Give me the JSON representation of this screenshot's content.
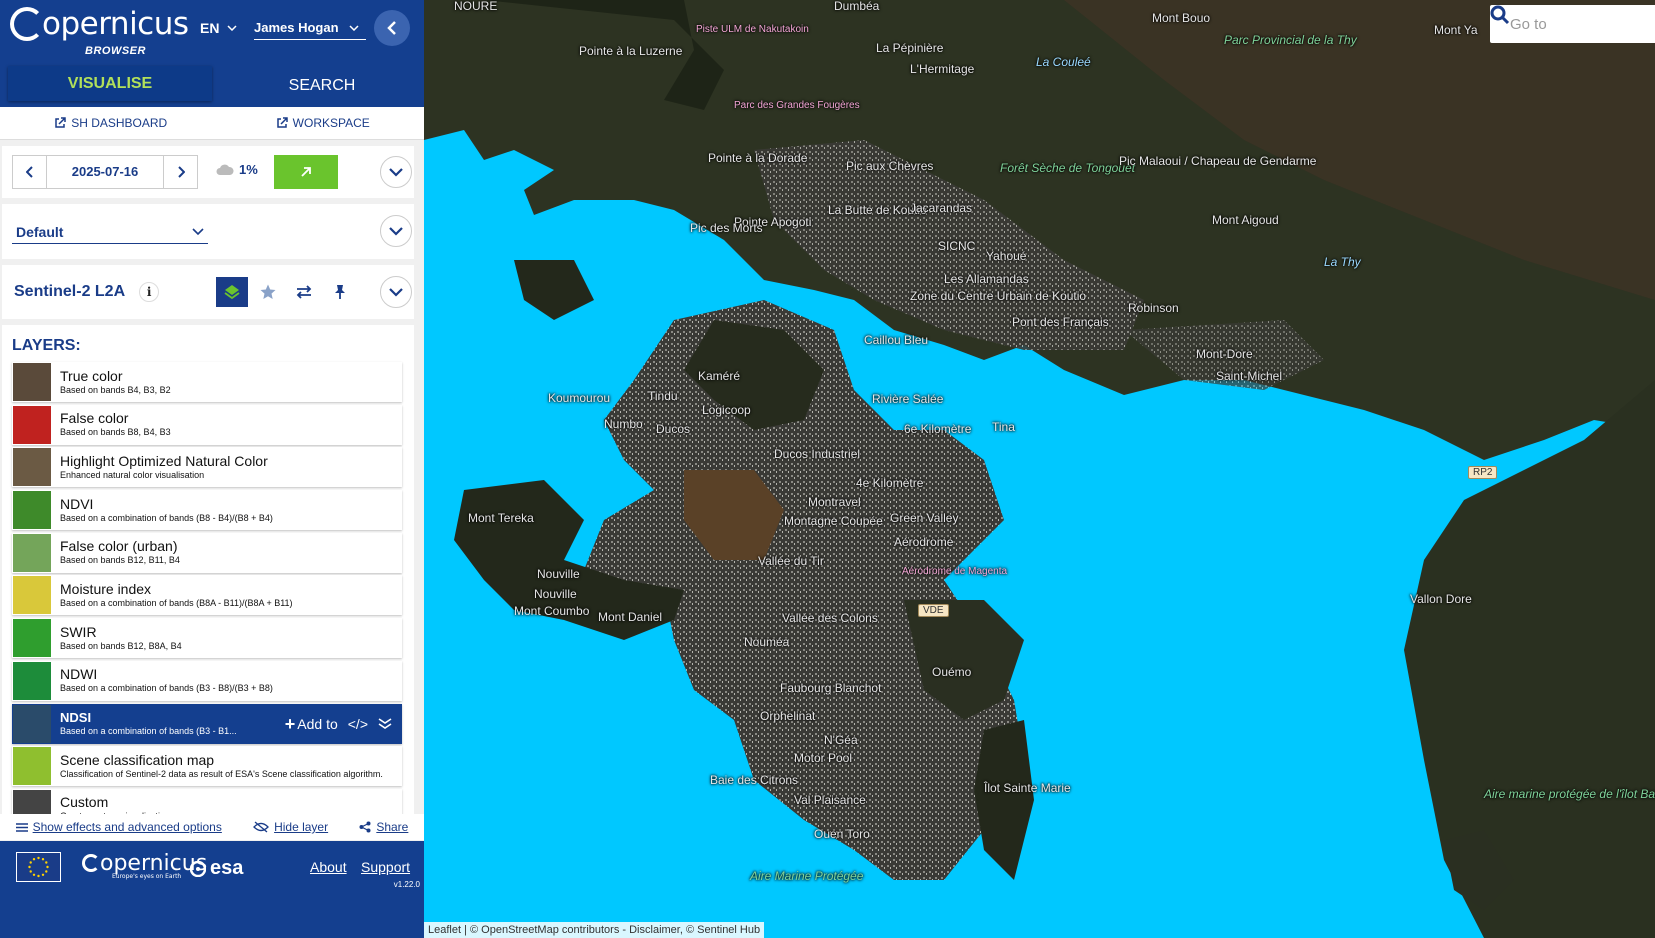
{
  "header": {
    "brand": "opernicus",
    "sub": "BROWSER",
    "lang": "EN",
    "user": "James Hogan"
  },
  "tabs": [
    {
      "label": "VISUALISE",
      "active": true
    },
    {
      "label": "SEARCH",
      "active": false
    }
  ],
  "links": {
    "dashboard": "SH DASHBOARD",
    "workspace": "WORKSPACE"
  },
  "date_panel": {
    "date": "2025-07-16",
    "cloud": "1%"
  },
  "theme": {
    "selected": "Default"
  },
  "dataset": {
    "title": "Sentinel-2 L2A"
  },
  "layers": {
    "title": "LAYERS:",
    "items": [
      {
        "name": "True color",
        "desc": "Based on bands B4, B3, B2",
        "thumb": "#5a4a3a"
      },
      {
        "name": "False color",
        "desc": "Based on bands B8, B4, B3",
        "thumb": "#c0221f"
      },
      {
        "name": "Highlight Optimized Natural Color",
        "desc": "Enhanced natural color visualisation",
        "thumb": "#6b5a44"
      },
      {
        "name": "NDVI",
        "desc": "Based on a combination of bands (B8 - B4)/(B8 + B4)",
        "thumb": "#3e8a2a"
      },
      {
        "name": "False color (urban)",
        "desc": "Based on bands B12, B11, B4",
        "thumb": "#74a55a"
      },
      {
        "name": "Moisture index",
        "desc": "Based on a combination of bands (B8A - B11)/(B8A + B11)",
        "thumb": "#d9c83a"
      },
      {
        "name": "SWIR",
        "desc": "Based on bands B12, B8A, B4",
        "thumb": "#2f9e2e"
      },
      {
        "name": "NDWI",
        "desc": "Based on a combination of bands (B3 - B8)/(B3 + B8)",
        "thumb": "#1d8c3a"
      },
      {
        "name": "NDSI",
        "desc": "Based on a combination of bands (B3 - B1...",
        "thumb": "#2a4b6a",
        "selected": true
      },
      {
        "name": "Scene classification map",
        "desc": "Classification of Sentinel-2 data as result of ESA's Scene classification algorithm.",
        "thumb": "#8fbf2f"
      },
      {
        "name": "Custom",
        "desc": "Create custom visualisation",
        "thumb": "#444444"
      }
    ],
    "add_to_label": "Add to",
    "code_label": "</>"
  },
  "bottom_links": {
    "effects": "Show effects and advanced options",
    "hide": "Hide layer",
    "share": "Share"
  },
  "footer": {
    "copernicus": "opernicus",
    "copernicus_tag": "Europe's eyes on Earth",
    "esa": "esa",
    "about": "About",
    "support": "Support",
    "version": "v1.22.0"
  },
  "map": {
    "search_placeholder": "Go to",
    "attribution": "Leaflet | © OpenStreetMap contributors - Disclaimer, © Sentinel Hub",
    "labels": [
      {
        "text": "NOURE",
        "cls": ""
      },
      {
        "text": "Dumbéa",
        "cls": ""
      },
      {
        "text": "Mont Bouo",
        "cls": ""
      },
      {
        "text": "Mont Ya",
        "cls": ""
      },
      {
        "text": "Parc Provincial de la Thy",
        "cls": "green"
      },
      {
        "text": "Piste ULM de Nakutakoin",
        "cls": "pink"
      },
      {
        "text": "Pointe à la Luzerne",
        "cls": ""
      },
      {
        "text": "La Pépinière",
        "cls": ""
      },
      {
        "text": "L'Hermitage",
        "cls": ""
      },
      {
        "text": "La Couleé",
        "cls": "blue"
      },
      {
        "text": "Parc des Grandes Fougères",
        "cls": "pink"
      },
      {
        "text": "Pointe à la Dorade",
        "cls": ""
      },
      {
        "text": "Pic aux Chèvres",
        "cls": ""
      },
      {
        "text": "Forêt Sèche de Tongouet",
        "cls": "green"
      },
      {
        "text": "Pic Malaoui / Chapeau de Gendarme",
        "cls": ""
      },
      {
        "text": "La Butte de Koutio",
        "cls": ""
      },
      {
        "text": "Jacarandas",
        "cls": ""
      },
      {
        "text": "Pointe Apogoti",
        "cls": ""
      },
      {
        "text": "Pic des Morts",
        "cls": ""
      },
      {
        "text": "SICNC",
        "cls": ""
      },
      {
        "text": "Yahoué",
        "cls": ""
      },
      {
        "text": "Mont Aigoud",
        "cls": ""
      },
      {
        "text": "La Thy",
        "cls": "blue"
      },
      {
        "text": "Les Allamandas",
        "cls": ""
      },
      {
        "text": "Zone du Centre Urbain de Koutio",
        "cls": ""
      },
      {
        "text": "Pont des Français",
        "cls": ""
      },
      {
        "text": "Robinson",
        "cls": ""
      },
      {
        "text": "Caillou Bleu",
        "cls": ""
      },
      {
        "text": "Mont-Dore",
        "cls": ""
      },
      {
        "text": "Saint-Michel",
        "cls": ""
      },
      {
        "text": "Kaméré",
        "cls": ""
      },
      {
        "text": "Koumourou",
        "cls": ""
      },
      {
        "text": "Tindu",
        "cls": ""
      },
      {
        "text": "Logicoop",
        "cls": ""
      },
      {
        "text": "Rivière Salée",
        "cls": ""
      },
      {
        "text": "Numbo",
        "cls": ""
      },
      {
        "text": "Ducos",
        "cls": ""
      },
      {
        "text": "6e Kilomètre",
        "cls": ""
      },
      {
        "text": "Tina",
        "cls": ""
      },
      {
        "text": "Ducos Industriel",
        "cls": ""
      },
      {
        "text": "4e Kilomètre",
        "cls": ""
      },
      {
        "text": "Montravel",
        "cls": ""
      },
      {
        "text": "Mont Tereka",
        "cls": ""
      },
      {
        "text": "Montagne Coupée",
        "cls": ""
      },
      {
        "text": "Green Valley",
        "cls": ""
      },
      {
        "text": "Aérodrome",
        "cls": ""
      },
      {
        "text": "Vallée du Tir",
        "cls": ""
      },
      {
        "text": "Aérodrome de Magenta",
        "cls": "pink"
      },
      {
        "text": "Nouville",
        "cls": ""
      },
      {
        "text": "Nouville",
        "cls": ""
      },
      {
        "text": "Mont Coumbo",
        "cls": ""
      },
      {
        "text": "Mont Daniel",
        "cls": ""
      },
      {
        "text": "Vallée des Colons",
        "cls": ""
      },
      {
        "text": "Vallon Dore",
        "cls": ""
      },
      {
        "text": "Nouméa",
        "cls": ""
      },
      {
        "text": "Ouémo",
        "cls": ""
      },
      {
        "text": "Faubourg Blanchot",
        "cls": ""
      },
      {
        "text": "Orphelinat",
        "cls": ""
      },
      {
        "text": "N'Géa",
        "cls": ""
      },
      {
        "text": "Motor Pool",
        "cls": ""
      },
      {
        "text": "Baie des Citrons",
        "cls": ""
      },
      {
        "text": "Îlot Sainte Marie",
        "cls": ""
      },
      {
        "text": "Val Plaisance",
        "cls": ""
      },
      {
        "text": "Aire marine protégée de l'îlot Bailly",
        "cls": "green"
      },
      {
        "text": "Ouen Toro",
        "cls": ""
      },
      {
        "text": "Aire Marine Protégée",
        "cls": "green"
      }
    ],
    "shields": [
      "RP2",
      "VDE"
    ]
  }
}
